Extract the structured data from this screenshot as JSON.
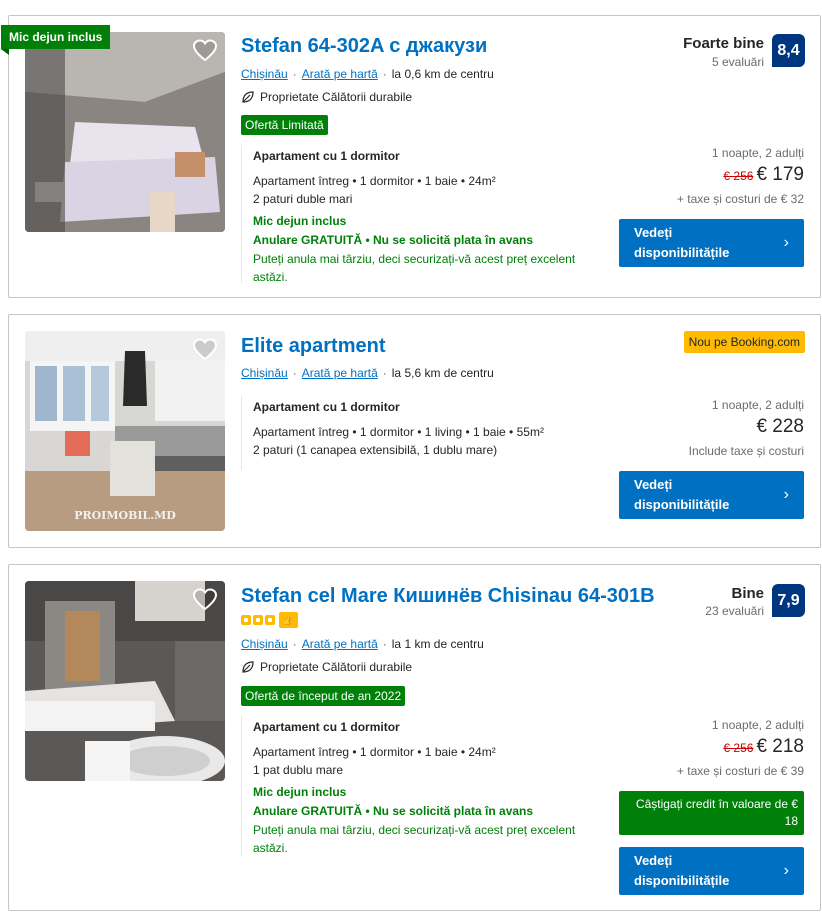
{
  "listings": [
    {
      "ribbon": "Mic dejun inclus",
      "title": "Stefan 64-302A с джакузи",
      "city": "Chișinău",
      "map_link": "Arată pe hartă",
      "distance": "la 0,6 km de centru",
      "sustainable": "Proprietate Călătorii durabile",
      "offer": "Ofertă Limitată",
      "unit_title": "Apartament cu 1 dormitor",
      "unit_details": "Apartament întreg • 1 dormitor • 1 baie • 24m²",
      "beds": "2 paturi duble mari",
      "breakfast": "Mic dejun inclus",
      "cancel": "Anulare GRATUITĂ • Nu se solicită plata în avans",
      "cancel_note": "Puteți anula mai târziu, deci securizați-vă acest preț excelent astăzi.",
      "review_word": "Foarte bine",
      "review_count": "5 evaluări",
      "score": "8,4",
      "nights": "1 noapte, 2 adulți",
      "old_price": "€ 256",
      "price": "€ 179",
      "taxes": "+ taxe și costuri de € 32",
      "button": "Vedeți disponibilitățile"
    },
    {
      "title": "Elite apartment",
      "city": "Chișinău",
      "map_link": "Arată pe hartă",
      "distance": "la 5,6 km de centru",
      "badge": "Nou pe Booking.com",
      "unit_title": "Apartament cu 1 dormitor",
      "unit_details": "Apartament întreg • 1 dormitor • 1 living • 1 baie • 55m²",
      "beds": "2 paturi (1 canapea extensibilă, 1 dublu mare)",
      "watermark": "PROIMOBIL.MD",
      "nights": "1 noapte, 2 adulți",
      "price": "€ 228",
      "taxes": "Include taxe și costuri",
      "button": "Vedeți disponibilitățile"
    },
    {
      "title": "Stefan cel Mare Кишинёв Chisinau 64-301B",
      "city": "Chișinău",
      "map_link": "Arată pe hartă",
      "distance": "la 1 km de centru",
      "sustainable": "Proprietate Călătorii durabile",
      "offer": "Ofertă de început de an 2022",
      "unit_title": "Apartament cu 1 dormitor",
      "unit_details": "Apartament întreg • 1 dormitor • 1 baie • 24m²",
      "beds": "1 pat dublu mare",
      "breakfast": "Mic dejun inclus",
      "cancel": "Anulare GRATUITĂ • Nu se solicită plata în avans",
      "cancel_note": "Puteți anula mai târziu, deci securizați-vă acest preț excelent astăzi.",
      "review_word": "Bine",
      "review_count": "23 evaluări",
      "score": "7,9",
      "nights": "1 noapte, 2 adulți",
      "old_price": "€ 256",
      "price": "€ 218",
      "taxes": "+ taxe și costuri de € 39",
      "credit": "Câștigați credit în valoare de € 18",
      "button": "Vedeți disponibilitățile"
    }
  ],
  "colors": {
    "link_blue": "#0071c2",
    "score_navy": "#003580",
    "green": "#008009",
    "badge_yellow": "#febb02",
    "old_price_red": "#cc0000"
  },
  "icons": {
    "favorite": "heart-outline-icon",
    "sustainable": "leaf-icon",
    "button_arrow": "chevron-right-icon",
    "stars": "square-rating-icons",
    "preferred": "thumbs-up-plus-icon"
  }
}
